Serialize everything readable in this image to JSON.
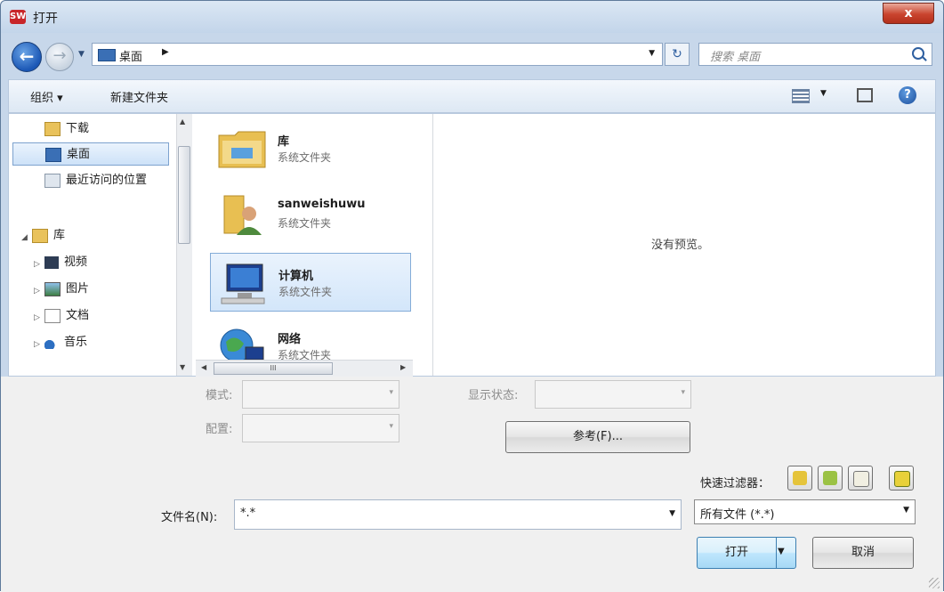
{
  "window": {
    "title": "打开",
    "app_icon": "autocad-icon",
    "close_label": "x"
  },
  "nav": {
    "breadcrumb": "桌面",
    "search_placeholder": "搜索 桌面"
  },
  "toolbar": {
    "organize": "组织 ▾",
    "new_folder": "新建文件夹"
  },
  "sidebar": {
    "favorites": [
      {
        "label": "下载",
        "icon": "download-folder-icon"
      },
      {
        "label": "桌面",
        "icon": "desktop-icon",
        "selected": true
      },
      {
        "label": "最近访问的位置",
        "icon": "recent-places-icon"
      }
    ],
    "libraries": {
      "label": "库",
      "icon": "library-icon"
    },
    "library_items": [
      {
        "label": "视频",
        "icon": "video-icon"
      },
      {
        "label": "图片",
        "icon": "pictures-icon"
      },
      {
        "label": "文档",
        "icon": "documents-icon"
      },
      {
        "label": "音乐",
        "icon": "music-icon"
      }
    ]
  },
  "files": [
    {
      "name": "库",
      "type": "系统文件夹",
      "icon": "library-folder-icon"
    },
    {
      "name": "sanweishuwu",
      "type": "系统文件夹",
      "icon": "user-folder-icon"
    },
    {
      "name": "计算机",
      "type": "系统文件夹",
      "icon": "computer-icon",
      "selected": true
    },
    {
      "name": "网络",
      "type": "系统文件夹",
      "icon": "network-icon"
    }
  ],
  "preview": {
    "message": "没有预览。"
  },
  "options": {
    "mode_label": "模式:",
    "config_label": "配置:",
    "display_state_label": "显示状态:",
    "browse_label": "参考(F)..."
  },
  "quick_filter": {
    "label": "快速过滤器：",
    "buttons": [
      "part-filter-icon",
      "assembly-filter-icon",
      "drawing-filter-icon",
      "top-level-filter-icon"
    ]
  },
  "filename": {
    "label": "文件名(N):",
    "value": "*.*"
  },
  "filetype": {
    "value": "所有文件 (*.*)"
  },
  "actions": {
    "open": "打开",
    "cancel": "取消"
  },
  "colors": {
    "selection": "#cde2f8",
    "accent": "#1b57b5",
    "close": "#c9442e"
  }
}
